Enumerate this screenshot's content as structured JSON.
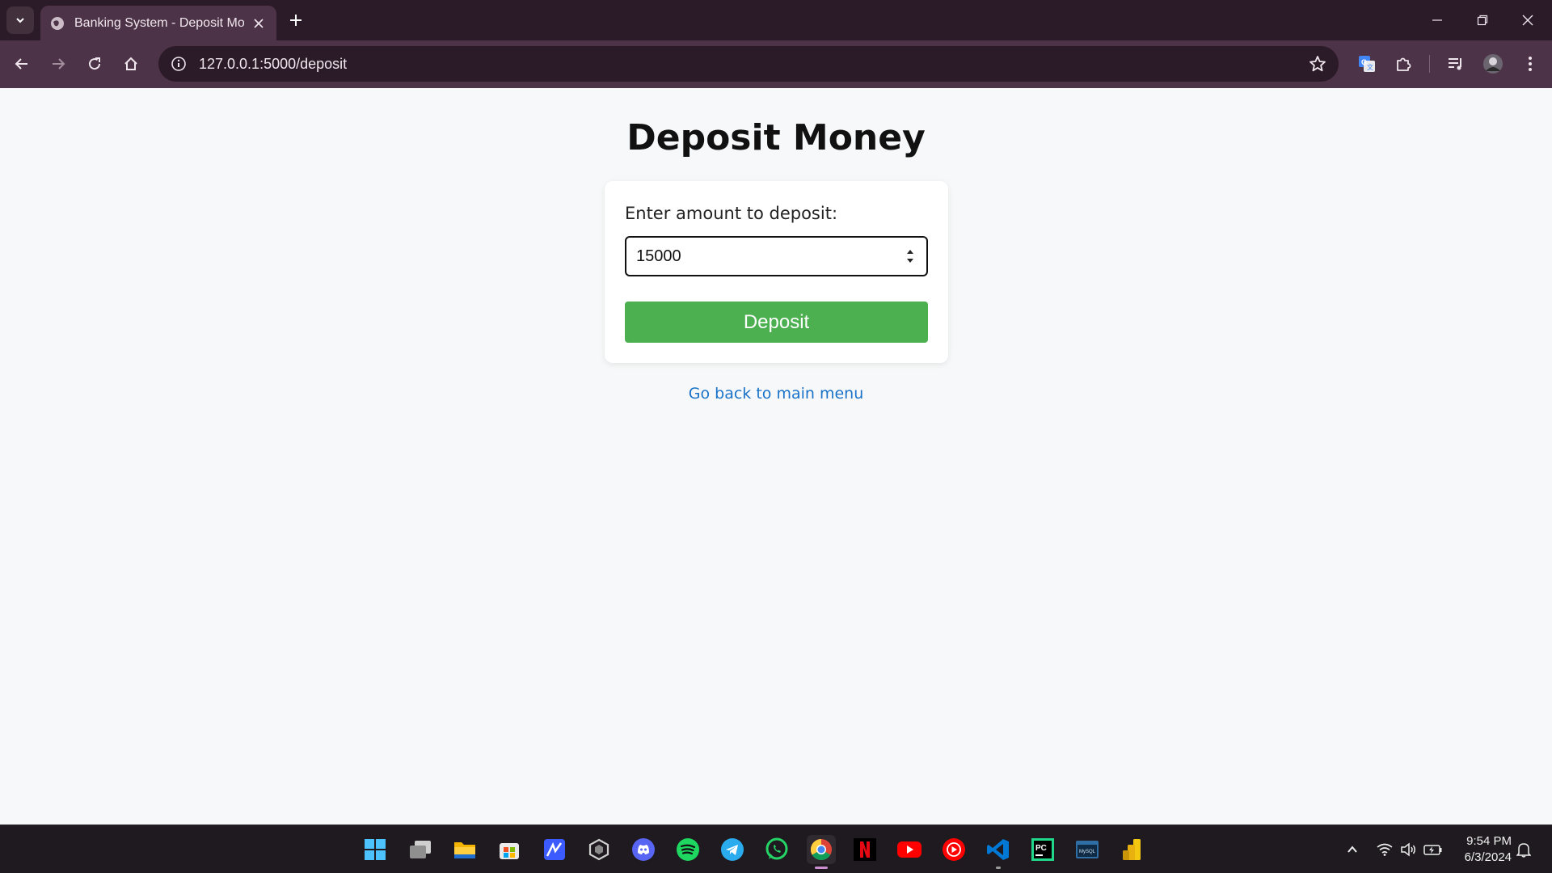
{
  "browser": {
    "tab_title": "Banking System - Deposit Money",
    "url": "127.0.0.1:5000/deposit"
  },
  "page": {
    "title": "Deposit Money",
    "label": "Enter amount to deposit:",
    "amount_value": "15000",
    "deposit_button": "Deposit",
    "back_link": "Go back to main menu"
  },
  "taskbar": {
    "apps": [
      "start-menu",
      "task-view",
      "file-explorer",
      "microsoft-store",
      "notes-app",
      "unity",
      "discord",
      "spotify",
      "telegram",
      "whatsapp",
      "chrome",
      "netflix",
      "youtube",
      "youtube-music",
      "vscode",
      "pycharm",
      "mysql-workbench",
      "power-bi"
    ],
    "time": "9:54 PM",
    "date": "6/3/2024"
  },
  "colors": {
    "accent_button": "#4caf50",
    "link": "#1a73c8",
    "chrome_frame": "#2b1a27",
    "chrome_toolbar": "#4d3347"
  }
}
